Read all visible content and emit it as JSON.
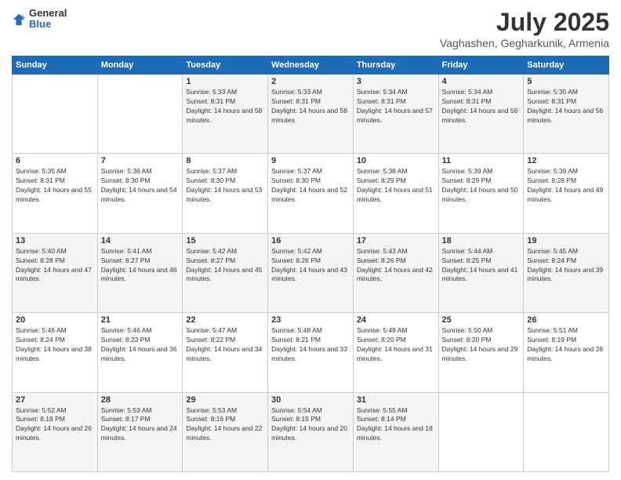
{
  "header": {
    "logo": {
      "general": "General",
      "blue": "Blue"
    },
    "title": "July 2025",
    "subtitle": "Vaghashen, Gegharkunik, Armenia"
  },
  "weekdays": [
    "Sunday",
    "Monday",
    "Tuesday",
    "Wednesday",
    "Thursday",
    "Friday",
    "Saturday"
  ],
  "weeks": [
    [
      {
        "day": "",
        "detail": ""
      },
      {
        "day": "",
        "detail": ""
      },
      {
        "day": "1",
        "sunrise": "5:33 AM",
        "sunset": "8:31 PM",
        "daylight": "14 hours and 58 minutes."
      },
      {
        "day": "2",
        "sunrise": "5:33 AM",
        "sunset": "8:31 PM",
        "daylight": "14 hours and 58 minutes."
      },
      {
        "day": "3",
        "sunrise": "5:34 AM",
        "sunset": "8:31 PM",
        "daylight": "14 hours and 57 minutes."
      },
      {
        "day": "4",
        "sunrise": "5:34 AM",
        "sunset": "8:31 PM",
        "daylight": "14 hours and 56 minutes."
      },
      {
        "day": "5",
        "sunrise": "5:35 AM",
        "sunset": "8:31 PM",
        "daylight": "14 hours and 56 minutes."
      }
    ],
    [
      {
        "day": "6",
        "sunrise": "5:35 AM",
        "sunset": "8:31 PM",
        "daylight": "14 hours and 55 minutes."
      },
      {
        "day": "7",
        "sunrise": "5:36 AM",
        "sunset": "8:30 PM",
        "daylight": "14 hours and 54 minutes."
      },
      {
        "day": "8",
        "sunrise": "5:37 AM",
        "sunset": "8:30 PM",
        "daylight": "14 hours and 53 minutes."
      },
      {
        "day": "9",
        "sunrise": "5:37 AM",
        "sunset": "8:30 PM",
        "daylight": "14 hours and 52 minutes."
      },
      {
        "day": "10",
        "sunrise": "5:38 AM",
        "sunset": "8:29 PM",
        "daylight": "14 hours and 51 minutes."
      },
      {
        "day": "11",
        "sunrise": "5:39 AM",
        "sunset": "8:29 PM",
        "daylight": "14 hours and 50 minutes."
      },
      {
        "day": "12",
        "sunrise": "5:39 AM",
        "sunset": "8:28 PM",
        "daylight": "14 hours and 49 minutes."
      }
    ],
    [
      {
        "day": "13",
        "sunrise": "5:40 AM",
        "sunset": "8:28 PM",
        "daylight": "14 hours and 47 minutes."
      },
      {
        "day": "14",
        "sunrise": "5:41 AM",
        "sunset": "8:27 PM",
        "daylight": "14 hours and 46 minutes."
      },
      {
        "day": "15",
        "sunrise": "5:42 AM",
        "sunset": "8:27 PM",
        "daylight": "14 hours and 45 minutes."
      },
      {
        "day": "16",
        "sunrise": "5:42 AM",
        "sunset": "8:26 PM",
        "daylight": "14 hours and 43 minutes."
      },
      {
        "day": "17",
        "sunrise": "5:43 AM",
        "sunset": "8:26 PM",
        "daylight": "14 hours and 42 minutes."
      },
      {
        "day": "18",
        "sunrise": "5:44 AM",
        "sunset": "8:25 PM",
        "daylight": "14 hours and 41 minutes."
      },
      {
        "day": "19",
        "sunrise": "5:45 AM",
        "sunset": "8:24 PM",
        "daylight": "14 hours and 39 minutes."
      }
    ],
    [
      {
        "day": "20",
        "sunrise": "5:46 AM",
        "sunset": "8:24 PM",
        "daylight": "14 hours and 38 minutes."
      },
      {
        "day": "21",
        "sunrise": "5:46 AM",
        "sunset": "8:23 PM",
        "daylight": "14 hours and 36 minutes."
      },
      {
        "day": "22",
        "sunrise": "5:47 AM",
        "sunset": "8:22 PM",
        "daylight": "14 hours and 34 minutes."
      },
      {
        "day": "23",
        "sunrise": "5:48 AM",
        "sunset": "8:21 PM",
        "daylight": "14 hours and 33 minutes."
      },
      {
        "day": "24",
        "sunrise": "5:49 AM",
        "sunset": "8:20 PM",
        "daylight": "14 hours and 31 minutes."
      },
      {
        "day": "25",
        "sunrise": "5:50 AM",
        "sunset": "8:20 PM",
        "daylight": "14 hours and 29 minutes."
      },
      {
        "day": "26",
        "sunrise": "5:51 AM",
        "sunset": "8:19 PM",
        "daylight": "14 hours and 28 minutes."
      }
    ],
    [
      {
        "day": "27",
        "sunrise": "5:52 AM",
        "sunset": "8:18 PM",
        "daylight": "14 hours and 26 minutes."
      },
      {
        "day": "28",
        "sunrise": "5:53 AM",
        "sunset": "8:17 PM",
        "daylight": "14 hours and 24 minutes."
      },
      {
        "day": "29",
        "sunrise": "5:53 AM",
        "sunset": "8:16 PM",
        "daylight": "14 hours and 22 minutes."
      },
      {
        "day": "30",
        "sunrise": "5:54 AM",
        "sunset": "8:15 PM",
        "daylight": "14 hours and 20 minutes."
      },
      {
        "day": "31",
        "sunrise": "5:55 AM",
        "sunset": "8:14 PM",
        "daylight": "14 hours and 18 minutes."
      },
      {
        "day": "",
        "detail": ""
      },
      {
        "day": "",
        "detail": ""
      }
    ]
  ]
}
